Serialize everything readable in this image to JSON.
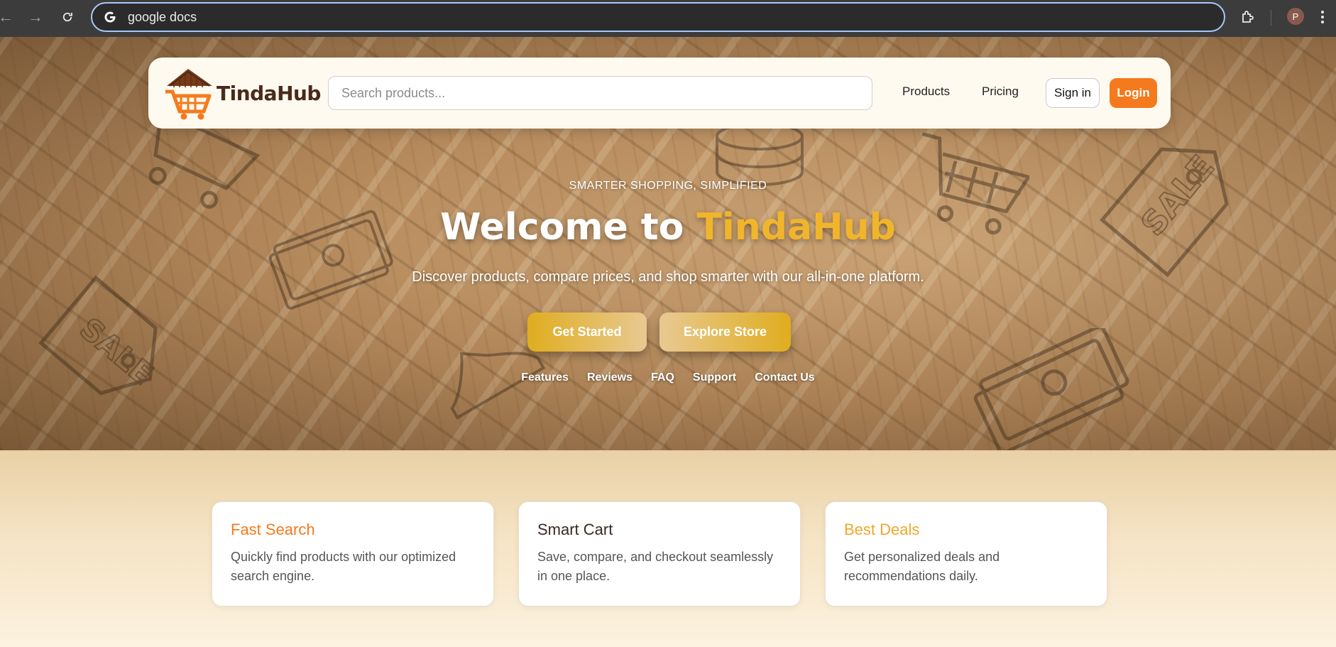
{
  "browser": {
    "url": "google docs",
    "profile_initial": "P"
  },
  "navbar": {
    "logo_text": "TindaHub",
    "search_placeholder": "Search products...",
    "links": [
      "Products",
      "Pricing"
    ],
    "signin_label": "Sign in",
    "login_label": "Login"
  },
  "hero": {
    "tagline": "SMARTER SHOPPING, SIMPLIFIED",
    "title_prefix": "Welcome to ",
    "title_brand": "TindaHub",
    "subtitle": "Discover products, compare prices, and shop smarter with our all-in-one platform.",
    "primary_cta": "Get Started",
    "secondary_cta": "Explore Store",
    "quick_links": [
      "Features",
      "Reviews",
      "FAQ",
      "Support",
      "Contact Us"
    ]
  },
  "features": [
    {
      "title": "Fast Search",
      "text": "Quickly find products with our optimized search engine.",
      "color": "#f47a1d"
    },
    {
      "title": "Smart Cart",
      "text": "Save, compare, and checkout seamlessly in one place.",
      "color": "#3a2a1f"
    },
    {
      "title": "Best Deals",
      "text": "Get personalized deals and recommendations daily.",
      "color": "#f0a72a"
    }
  ],
  "colors": {
    "accent_orange": "#f47a1d",
    "brand_gold": "#f1b52c",
    "logo_brown": "#4a2a1a"
  }
}
